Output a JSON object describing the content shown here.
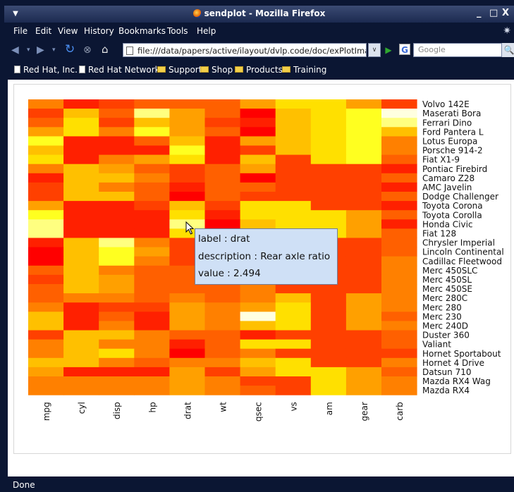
{
  "window": {
    "title": "sendplot - Mozilla Firefox",
    "controls": [
      "_",
      "□",
      "X"
    ]
  },
  "menu": [
    "File",
    "Edit",
    "View",
    "History",
    "Bookmarks",
    "Tools",
    "Help"
  ],
  "nav": {
    "url": "file:///data/papers/active/ilayout/dvlp.code/doc/exPlotImage.htr",
    "search_placeholder": "Google",
    "google_badge": "G"
  },
  "bookmarks": [
    {
      "label": "Red Hat, Inc.",
      "icon": "page-icon"
    },
    {
      "label": "Red Hat Network",
      "icon": "page-icon"
    },
    {
      "label": "Support",
      "icon": "folder-icon"
    },
    {
      "label": "Shop",
      "icon": "folder-icon"
    },
    {
      "label": "Products",
      "icon": "folder-icon"
    },
    {
      "label": "Training",
      "icon": "folder-icon"
    }
  ],
  "status": "Done",
  "tooltip": {
    "label": "label   : drat",
    "description": "description   : Rear axle ratio",
    "value": "value   : 2.494"
  },
  "chart_data": {
    "type": "heatmap",
    "x": [
      "mpg",
      "cyl",
      "disp",
      "hp",
      "drat",
      "wt",
      "qsec",
      "vs",
      "am",
      "gear",
      "carb"
    ],
    "y": [
      "Volvo 142E",
      "Maserati Bora",
      "Ferrari Dino",
      "Ford Pantera L",
      "Lotus Europa",
      "Porsche 914-2",
      "Fiat X1-9",
      "Pontiac Firebird",
      "Camaro Z28",
      "AMC Javelin",
      "Dodge Challenger",
      "Toyota Corona",
      "Toyota Corolla",
      "Honda Civic",
      "Fiat 128",
      "Chrysler Imperial",
      "Lincoln Continental",
      "Cadillac Fleetwood",
      "Merc 450SLC",
      "Merc 450SL",
      "Merc 450SE",
      "Merc 280C",
      "Merc 280",
      "Merc 230",
      "Merc 240D",
      "Duster 360",
      "Valiant",
      "Hornet Sportabout",
      "Hornet 4 Drive",
      "Datsun 710",
      "Mazda RX4 Wag",
      "Mazda RX4"
    ],
    "colormap": [
      "#ff0000",
      "#ff2000",
      "#ff4000",
      "#ff6000",
      "#ff8000",
      "#ffa000",
      "#ffc000",
      "#ffe000",
      "#ffff20",
      "#ffff80",
      "#ffffe0"
    ],
    "values": [
      [
        4,
        1,
        2,
        3,
        3,
        3,
        5,
        7,
        7,
        5,
        2
      ],
      [
        2,
        6,
        3,
        9,
        5,
        3,
        0,
        6,
        7,
        8,
        10
      ],
      [
        3,
        7,
        2,
        6,
        5,
        2,
        1,
        6,
        7,
        8,
        9
      ],
      [
        5,
        7,
        4,
        8,
        5,
        3,
        0,
        6,
        7,
        8,
        6
      ],
      [
        8,
        1,
        1,
        3,
        6,
        1,
        5,
        6,
        7,
        8,
        4
      ],
      [
        6,
        1,
        1,
        1,
        8,
        1,
        2,
        6,
        7,
        8,
        4
      ],
      [
        7,
        1,
        4,
        5,
        7,
        1,
        6,
        2,
        7,
        8,
        3
      ],
      [
        4,
        6,
        5,
        3,
        2,
        3,
        5,
        2,
        2,
        2,
        1
      ],
      [
        1,
        6,
        6,
        4,
        2,
        3,
        0,
        2,
        2,
        2,
        3
      ],
      [
        2,
        6,
        4,
        3,
        1,
        3,
        3,
        2,
        2,
        2,
        1
      ],
      [
        2,
        6,
        6,
        3,
        0,
        3,
        2,
        2,
        2,
        2,
        3
      ],
      [
        5,
        1,
        1,
        2,
        6,
        2,
        7,
        7,
        2,
        2,
        1
      ],
      [
        8,
        1,
        1,
        1,
        7,
        1,
        7,
        7,
        7,
        5,
        3
      ],
      [
        9,
        1,
        1,
        1,
        9,
        0,
        6,
        7,
        7,
        5,
        1
      ],
      [
        9,
        1,
        1,
        1,
        7,
        1,
        6,
        7,
        7,
        5,
        3
      ],
      [
        1,
        6,
        9,
        4,
        2,
        3,
        3,
        2,
        2,
        2,
        3
      ],
      [
        0,
        6,
        8,
        5,
        2,
        3,
        3,
        2,
        2,
        2,
        3
      ],
      [
        0,
        6,
        8,
        4,
        2,
        3,
        3,
        2,
        2,
        2,
        4
      ],
      [
        3,
        6,
        4,
        3,
        3,
        4,
        4,
        2,
        2,
        2,
        4
      ],
      [
        2,
        6,
        5,
        3,
        3,
        3,
        4,
        2,
        2,
        2,
        4
      ],
      [
        3,
        6,
        5,
        3,
        3,
        3,
        4,
        2,
        2,
        2,
        4
      ],
      [
        3,
        4,
        4,
        3,
        4,
        3,
        4,
        6,
        2,
        5,
        4
      ],
      [
        4,
        1,
        2,
        2,
        5,
        4,
        5,
        7,
        2,
        5,
        4
      ],
      [
        6,
        1,
        3,
        1,
        5,
        4,
        10,
        7,
        2,
        5,
        3
      ],
      [
        6,
        1,
        4,
        1,
        5,
        4,
        6,
        7,
        2,
        5,
        4
      ],
      [
        2,
        6,
        6,
        4,
        3,
        3,
        1,
        2,
        2,
        2,
        3
      ],
      [
        4,
        6,
        4,
        4,
        1,
        3,
        7,
        7,
        2,
        2,
        3
      ],
      [
        4,
        6,
        7,
        4,
        0,
        3,
        4,
        2,
        2,
        2,
        2
      ],
      [
        6,
        6,
        4,
        3,
        4,
        4,
        6,
        7,
        2,
        2,
        4
      ],
      [
        5,
        1,
        1,
        1,
        5,
        2,
        5,
        7,
        7,
        5,
        3
      ],
      [
        4,
        4,
        4,
        4,
        5,
        4,
        2,
        2,
        7,
        5,
        4
      ],
      [
        4,
        4,
        4,
        4,
        5,
        4,
        3,
        2,
        7,
        5,
        4
      ]
    ]
  }
}
